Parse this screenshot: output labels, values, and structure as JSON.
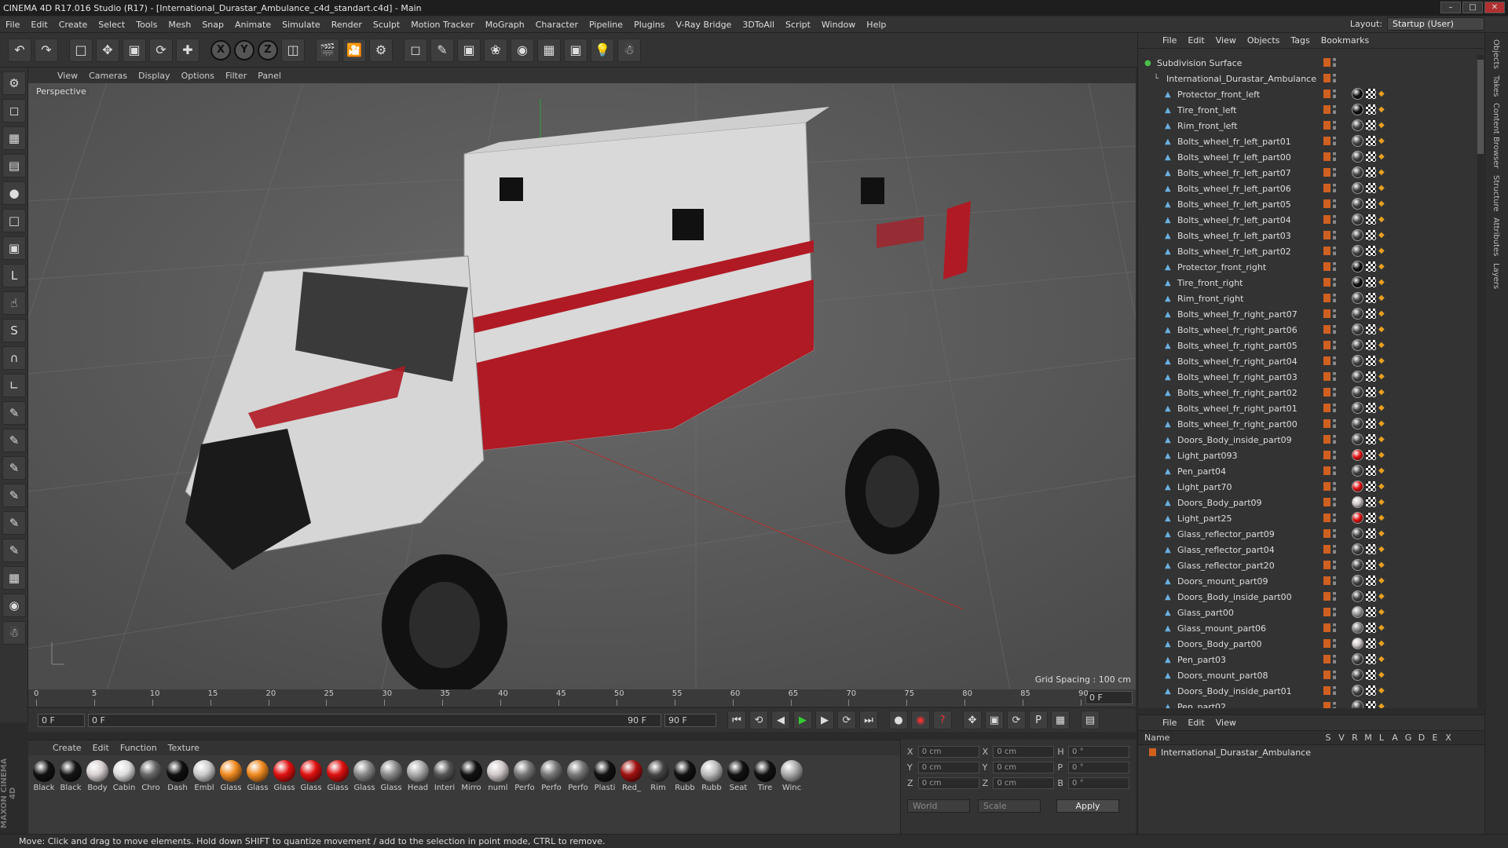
{
  "window": {
    "title": "CINEMA 4D R17.016 Studio (R17) - [International_Durastar_Ambulance_c4d_standart.c4d] - Main"
  },
  "menu": [
    "File",
    "Edit",
    "Create",
    "Select",
    "Tools",
    "Mesh",
    "Snap",
    "Animate",
    "Simulate",
    "Render",
    "Sculpt",
    "Motion Tracker",
    "MoGraph",
    "Character",
    "Pipeline",
    "Plugins",
    "V-Ray Bridge",
    "3DToAll",
    "Script",
    "Window",
    "Help"
  ],
  "layout": {
    "label": "Layout:",
    "value": "Startup (User)"
  },
  "viewport": {
    "menu": [
      "View",
      "Cameras",
      "Display",
      "Options",
      "Filter",
      "Panel"
    ],
    "label": "Perspective",
    "grid_spacing": "Grid Spacing : 100 cm"
  },
  "timeline": {
    "ticks": [
      "0",
      "5",
      "10",
      "15",
      "20",
      "25",
      "30",
      "35",
      "40",
      "45",
      "50",
      "55",
      "60",
      "65",
      "70",
      "75",
      "80",
      "85",
      "90"
    ],
    "current_frame": "0 F"
  },
  "transport": {
    "start": "0 F",
    "range_start": "0 F",
    "range_end": "90 F",
    "end": "90 F"
  },
  "materials": {
    "menu": [
      "Create",
      "Edit",
      "Function",
      "Texture"
    ],
    "items": [
      {
        "name": "Black",
        "color": "#111111"
      },
      {
        "name": "Black",
        "color": "#151515"
      },
      {
        "name": "Body",
        "color": "#d8d0d0"
      },
      {
        "name": "Cabin",
        "color": "#dddddd"
      },
      {
        "name": "Chro",
        "color": "#666666"
      },
      {
        "name": "Dash",
        "color": "#101010"
      },
      {
        "name": "Embl",
        "color": "#cccccc"
      },
      {
        "name": "Glass",
        "color": "#f08a20"
      },
      {
        "name": "Glass",
        "color": "#f08a20"
      },
      {
        "name": "Glass",
        "color": "#e01010"
      },
      {
        "name": "Glass",
        "color": "#e01010"
      },
      {
        "name": "Glass",
        "color": "#e01010"
      },
      {
        "name": "Glass",
        "color": "#888888"
      },
      {
        "name": "Glass",
        "color": "#8a8a8a"
      },
      {
        "name": "Head",
        "color": "#aaaaaa"
      },
      {
        "name": "Interi",
        "color": "#555555"
      },
      {
        "name": "Mirro",
        "color": "#111111"
      },
      {
        "name": "numl",
        "color": "#d0c8c8"
      },
      {
        "name": "Perfo",
        "color": "#777777"
      },
      {
        "name": "Perfo",
        "color": "#777777"
      },
      {
        "name": "Perfo",
        "color": "#777777"
      },
      {
        "name": "Plasti",
        "color": "#111111"
      },
      {
        "name": "Red_",
        "color": "#a01010"
      },
      {
        "name": "Rim",
        "color": "#444444"
      },
      {
        "name": "Rubb",
        "color": "#111111"
      },
      {
        "name": "Rubb",
        "color": "#bbbbbb"
      },
      {
        "name": "Seat",
        "color": "#111111"
      },
      {
        "name": "Tire",
        "color": "#111111"
      },
      {
        "name": "Winc",
        "color": "#aaaaaa"
      }
    ]
  },
  "coords": {
    "rows": [
      {
        "a": "X",
        "av": "0 cm",
        "b": "X",
        "bv": "0 cm",
        "c": "H",
        "cv": "0 °"
      },
      {
        "a": "Y",
        "av": "0 cm",
        "b": "Y",
        "bv": "0 cm",
        "c": "P",
        "cv": "0 °"
      },
      {
        "a": "Z",
        "av": "0 cm",
        "b": "Z",
        "bv": "0 cm",
        "c": "B",
        "cv": "0 °"
      }
    ],
    "world": "World",
    "scale": "Scale",
    "apply": "Apply"
  },
  "objects": {
    "menu": [
      "File",
      "Edit",
      "View",
      "Objects",
      "Tags",
      "Bookmarks"
    ],
    "root": "Subdivision Surface",
    "group": "International_Durastar_Ambulance",
    "items": [
      {
        "name": "Protector_front_left",
        "tag": "#111111"
      },
      {
        "name": "Tire_front_left",
        "tag": "#111111"
      },
      {
        "name": "Rim_front_left",
        "tag": "#444444"
      },
      {
        "name": "Bolts_wheel_fr_left_part01",
        "tag": "#444444"
      },
      {
        "name": "Bolts_wheel_fr_left_part00",
        "tag": "#444444"
      },
      {
        "name": "Bolts_wheel_fr_left_part07",
        "tag": "#444444"
      },
      {
        "name": "Bolts_wheel_fr_left_part06",
        "tag": "#444444"
      },
      {
        "name": "Bolts_wheel_fr_left_part05",
        "tag": "#444444"
      },
      {
        "name": "Bolts_wheel_fr_left_part04",
        "tag": "#444444"
      },
      {
        "name": "Bolts_wheel_fr_left_part03",
        "tag": "#444444"
      },
      {
        "name": "Bolts_wheel_fr_left_part02",
        "tag": "#444444"
      },
      {
        "name": "Protector_front_right",
        "tag": "#111111"
      },
      {
        "name": "Tire_front_right",
        "tag": "#111111"
      },
      {
        "name": "Rim_front_right",
        "tag": "#444444"
      },
      {
        "name": "Bolts_wheel_fr_right_part07",
        "tag": "#444444"
      },
      {
        "name": "Bolts_wheel_fr_right_part06",
        "tag": "#444444"
      },
      {
        "name": "Bolts_wheel_fr_right_part05",
        "tag": "#444444"
      },
      {
        "name": "Bolts_wheel_fr_right_part04",
        "tag": "#444444"
      },
      {
        "name": "Bolts_wheel_fr_right_part03",
        "tag": "#444444"
      },
      {
        "name": "Bolts_wheel_fr_right_part02",
        "tag": "#444444"
      },
      {
        "name": "Bolts_wheel_fr_right_part01",
        "tag": "#444444"
      },
      {
        "name": "Bolts_wheel_fr_right_part00",
        "tag": "#444444"
      },
      {
        "name": "Doors_Body_inside_part09",
        "tag": "#444444"
      },
      {
        "name": "Light_part093",
        "tag": "#e01010"
      },
      {
        "name": "Pen_part04",
        "tag": "#444444"
      },
      {
        "name": "Light_part70",
        "tag": "#e01010"
      },
      {
        "name": "Doors_Body_part09",
        "tag": "#d0c8c8"
      },
      {
        "name": "Light_part25",
        "tag": "#e01010"
      },
      {
        "name": "Glass_reflector_part09",
        "tag": "#444444"
      },
      {
        "name": "Glass_reflector_part04",
        "tag": "#444444"
      },
      {
        "name": "Glass_reflector_part20",
        "tag": "#444444"
      },
      {
        "name": "Doors_mount_part09",
        "tag": "#444444"
      },
      {
        "name": "Doors_Body_inside_part00",
        "tag": "#444444"
      },
      {
        "name": "Glass_part00",
        "tag": "#999999"
      },
      {
        "name": "Glass_mount_part06",
        "tag": "#888888"
      },
      {
        "name": "Doors_Body_part00",
        "tag": "#d0c8c8"
      },
      {
        "name": "Pen_part03",
        "tag": "#444444"
      },
      {
        "name": "Doors_mount_part08",
        "tag": "#444444"
      },
      {
        "name": "Doors_Body_inside_part01",
        "tag": "#444444"
      },
      {
        "name": "Pen_part02",
        "tag": "#444444"
      }
    ]
  },
  "attributes": {
    "menu": [
      "File",
      "Edit",
      "View"
    ],
    "name_col": "Name",
    "cols": [
      "S",
      "V",
      "R",
      "M",
      "L",
      "A",
      "G",
      "D",
      "E",
      "X"
    ],
    "row": "International_Durastar_Ambulance"
  },
  "right_tabs": [
    "Objects",
    "Takes",
    "Content Browser",
    "Structure",
    "Attributes",
    "Layers"
  ],
  "status": "Move: Click and drag to move elements. Hold down SHIFT to quantize movement / add to the selection in point mode, CTRL to remove.",
  "logo": "MAXON CINEMA 4D"
}
